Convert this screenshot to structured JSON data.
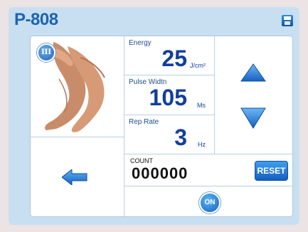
{
  "header": {
    "title": "P-808",
    "save_icon": "save-icon"
  },
  "treatment": {
    "mode_badge": "III",
    "image": "legs-photo"
  },
  "params": {
    "energy": {
      "label": "Energy",
      "value": "25",
      "unit": "J/cm²"
    },
    "pulse_width": {
      "label": "Pulse Widtn",
      "value": "105",
      "unit": "Ms"
    },
    "rep_rate": {
      "label": "Rep Rate",
      "value": "3",
      "unit": "Hz"
    }
  },
  "controls": {
    "up_icon": "triangle-up-icon",
    "down_icon": "triangle-down-icon",
    "back_icon": "arrow-left-icon"
  },
  "counter": {
    "label": "COUNT",
    "value": "000000",
    "reset_label": "RESET"
  },
  "power": {
    "label": "ON"
  },
  "colors": {
    "accent": "#1d64b0",
    "background": "#c8dff1",
    "value_text": "#123f9a"
  }
}
